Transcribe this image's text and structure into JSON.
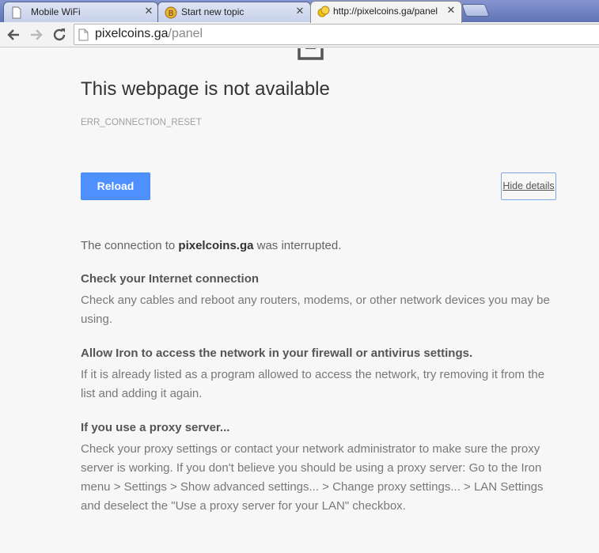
{
  "tabs": [
    {
      "title": "Mobile WiFi",
      "icon": "blank-page-icon",
      "active": false
    },
    {
      "title": "Start new topic",
      "icon": "bitcoin-coin-icon",
      "active": false
    },
    {
      "title": "http://pixelcoins.ga/panel",
      "icon": "coins-icon",
      "active": true
    }
  ],
  "toolbar": {
    "url_host": "pixelcoins.ga",
    "url_path": "/panel"
  },
  "error": {
    "title": "This webpage is not available",
    "code": "ERR_CONNECTION_RESET",
    "reload_label": "Reload",
    "details_label": "Hide details",
    "summary_prefix": "The connection to ",
    "summary_host": "pixelcoins.ga",
    "summary_suffix": " was interrupted.",
    "sections": [
      {
        "heading": "Check your Internet connection",
        "body": "Check any cables and reboot any routers, modems, or other network devices you may be using."
      },
      {
        "heading": "Allow Iron to access the network in your firewall or antivirus settings.",
        "body": "If it is already listed as a program allowed to access the network, try removing it from the list and adding it again."
      },
      {
        "heading": "If you use a proxy server...",
        "body": "Check your proxy settings or contact your network administrator to make sure the proxy server is working. If you don't believe you should be using a proxy server: Go to the Iron menu > Settings > Show advanced settings... > Change proxy settings... > LAN Settings and deselect the \"Use a proxy server for your LAN\" checkbox."
      }
    ]
  },
  "colors": {
    "reload_button": "#4d90fe",
    "tabstrip": "#6b7fbd",
    "page_background": "#f7f7f7"
  }
}
